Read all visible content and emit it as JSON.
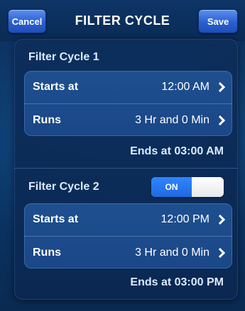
{
  "header": {
    "title": "FILTER CYCLE",
    "cancel_label": "Cancel",
    "save_label": "Save"
  },
  "filter_cycle_1": {
    "title": "Filter Cycle 1",
    "starts_label": "Starts at",
    "starts_value": "12:00 AM",
    "runs_label": "Runs",
    "runs_value": "3 Hr and 0 Min",
    "ends_text": "Ends at 03:00 AM"
  },
  "filter_cycle_2": {
    "title": "Filter Cycle 2",
    "toggle_label": "ON",
    "toggle_state": "on",
    "starts_label": "Starts at",
    "starts_value": "12:00 PM",
    "runs_label": "Runs",
    "runs_value": "3 Hr and 0 Min",
    "ends_text": "Ends at 03:00 PM"
  },
  "colors": {
    "background": "#0a2a52",
    "accent_button": "#2b5fd0",
    "toggle_on": "#2f86ff"
  }
}
